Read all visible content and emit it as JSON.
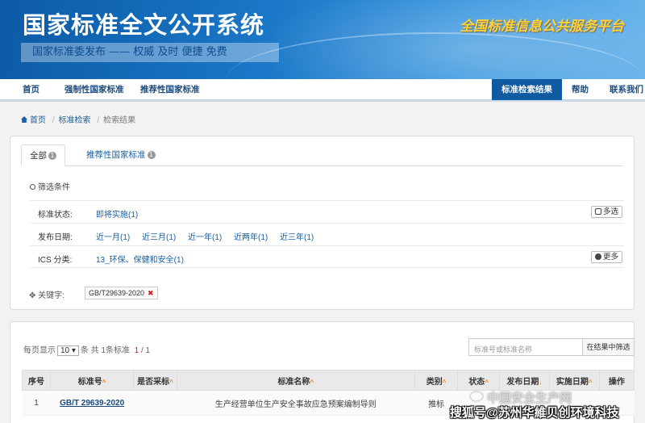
{
  "header": {
    "site_title": "国家标准全文公开系统",
    "slogan": "国家标准委发布 —— 权威  及时  便捷  免费",
    "platform": "全国标准信息公共服务平台"
  },
  "nav": {
    "home": "首页",
    "mandatory": "强制性国家标准",
    "recommended": "推荐性国家标准",
    "results": "标准检索结果",
    "help": "帮助",
    "contact": "联系我们"
  },
  "breadcrumb": [
    "首页",
    "标准检索",
    "检索结果"
  ],
  "tabs": [
    {
      "label": "全部",
      "count": "1"
    },
    {
      "label": "推荐性国家标准",
      "count": "1"
    }
  ],
  "filter": {
    "title": "筛选条件",
    "status_label": "标准状态:",
    "status_options": [
      "即将实施(1)"
    ],
    "multi_btn": "多选",
    "date_label": "发布日期:",
    "date_options": [
      "近一月(1)",
      "近三月(1)",
      "近一年(1)",
      "近两年(1)",
      "近三年(1)"
    ],
    "ics_label": "ICS 分类:",
    "ics_options": [
      "13_环保、保健和安全(1)"
    ],
    "more_btn": "更多",
    "keyword_label": "关键字:",
    "keyword": "GB/T29639-2020"
  },
  "results": {
    "per_page_label": "每页显示",
    "per_page": "10 ▾",
    "summary_pre": "条 共",
    "total": "1",
    "summary_post": "条标准",
    "page_current": "1",
    "page_sep": "/",
    "page_total": "1",
    "search_placeholder": "标准号或标准名称",
    "search_btn": "在结果中筛选",
    "columns": [
      "序号",
      "标准号",
      "是否采标",
      "标准名称",
      "类别",
      "状态",
      "发布日期",
      "实施日期",
      "操作"
    ],
    "rows": [
      {
        "no": "1",
        "code": "GB/T 29639-2020",
        "adopted": "",
        "name": "生产经营单位生产安全事故应急预案编制导则",
        "type": "推标",
        "status": "",
        "pub": "",
        "impl": "",
        "op": ""
      }
    ]
  },
  "watermark": {
    "line1": "中国安全生产网",
    "line2": "搜狐号@苏州华維贝创环境科技"
  },
  "colors": {
    "banner": "#1a76c6",
    "nav_active": "#0f5aa0",
    "link": "#1a5fa0",
    "sort_arrow": "#e08a1a",
    "remove": "#d21a1a"
  }
}
